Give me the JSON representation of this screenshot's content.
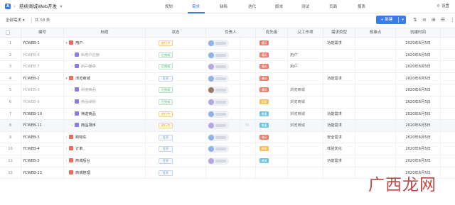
{
  "app": {
    "logo_letter": "A",
    "breadcrumb_sep": "›",
    "project_name": "慈续商城Web开发",
    "project_caret": "▾"
  },
  "nav": {
    "tabs": [
      {
        "label": "规划",
        "active": false
      },
      {
        "label": "需求",
        "active": true
      },
      {
        "label": "缺陷",
        "active": false
      },
      {
        "label": "迭代",
        "active": false
      },
      {
        "label": "版本",
        "active": false
      },
      {
        "label": "测试",
        "active": false
      },
      {
        "label": "页面",
        "active": false
      },
      {
        "label": "报表",
        "active": false
      }
    ],
    "settings_label": "设置",
    "accent": "#3b7be8"
  },
  "toolbar": {
    "view_label": "全部需求 ▾",
    "count_label": "共 58 条",
    "new_button_label": "+ 新建",
    "new_button_caret": "▾",
    "icons": [
      "sort-icon",
      "filter-icon",
      "group-icon",
      "display-icon",
      "more-icon"
    ]
  },
  "table": {
    "headers": [
      "编号",
      "标题",
      "状态",
      "负责人",
      "优先级",
      "父工作项",
      "需求类型",
      "故事点",
      "创建时间"
    ],
    "rows": [
      {
        "num": "1",
        "id": "YCWEB-1",
        "title": "用户",
        "level": 0,
        "kind": "feature",
        "expand": "down",
        "status": "进行中",
        "status_kind": "done",
        "owner": "blue",
        "priority": "最高",
        "priority_kind": "high",
        "parent": "",
        "type": "功能需求",
        "story": "",
        "date": "2020年6月5日",
        "muted": false
      },
      {
        "num": "2",
        "id": "YCWEB-6",
        "title": "新用户注册",
        "level": 1,
        "kind": "story",
        "expand": "right",
        "status": "已完成",
        "status_kind": "closed",
        "owner": "blue",
        "priority": "最高",
        "priority_kind": "high",
        "parent": "用户",
        "type": "",
        "story": "",
        "date": "2020年6月5日",
        "muted": true
      },
      {
        "num": "3",
        "id": "YCWEB-7",
        "title": "用户登录",
        "level": 1,
        "kind": "story",
        "expand": "right",
        "status": "已完成",
        "status_kind": "closed",
        "owner": "purple",
        "priority": "最高",
        "priority_kind": "high",
        "parent": "用户",
        "type": "",
        "story": "",
        "date": "2020年6月5日",
        "muted": true
      },
      {
        "num": "4",
        "id": "YCWEB-2",
        "title": "浏览商城",
        "level": 0,
        "kind": "feature",
        "expand": "down",
        "status": "打开",
        "status_kind": "open",
        "owner": "blue",
        "priority": "最高",
        "priority_kind": "high",
        "parent": "",
        "type": "功能需求",
        "story": "",
        "date": "2020年6月5日",
        "muted": false
      },
      {
        "num": "5",
        "id": "YCWEB-8",
        "title": "浏览商品",
        "level": 1,
        "kind": "story",
        "expand": "right",
        "status": "已完成",
        "status_kind": "closed",
        "owner": "brown",
        "priority": "最高",
        "priority_kind": "high",
        "parent": "浏览商城",
        "type": "",
        "story": "",
        "date": "2020年6月5日",
        "muted": true
      },
      {
        "num": "6",
        "id": "YCWEB-9",
        "title": "商品详情",
        "level": 1,
        "kind": "story",
        "expand": "right",
        "status": "已完成",
        "status_kind": "closed",
        "owner": "purple",
        "priority": "较高",
        "priority_kind": "mid",
        "parent": "浏览商城",
        "type": "",
        "story": "",
        "date": "2020年6月5日",
        "muted": true
      },
      {
        "num": "7",
        "id": "YCWEB-10",
        "title": "筛选商品",
        "level": 1,
        "kind": "story",
        "expand": "right",
        "status": "进行中",
        "status_kind": "done",
        "owner": "blue",
        "priority": "普通",
        "priority_kind": "low",
        "parent": "浏览商城",
        "type": "功能需求",
        "story": "",
        "date": "2020年6月5日",
        "muted": false
      },
      {
        "num": "8",
        "id": "YCWEB-11",
        "title": "商品排序",
        "level": 1,
        "kind": "story",
        "expand": "right",
        "status": "进行中",
        "status_kind": "done",
        "owner": "purple",
        "priority": "普通",
        "priority_kind": "low",
        "parent": "浏览商城",
        "type": "功能需求",
        "story": "",
        "date": "2020年6月5日",
        "muted": false,
        "selected": true
      },
      {
        "num": "9",
        "id": "YCWEB-3",
        "title": "购物车",
        "level": 0,
        "kind": "feature",
        "expand": "right",
        "status": "打开",
        "status_kind": "open",
        "owner": "blue",
        "priority": "最高",
        "priority_kind": "high",
        "parent": "",
        "type": "安全需求",
        "story": "",
        "date": "2020年6月5日",
        "muted": false
      },
      {
        "num": "10",
        "id": "YCWEB-4",
        "title": "订单",
        "level": 0,
        "kind": "feature",
        "expand": "right",
        "status": "打开",
        "status_kind": "open",
        "owner": "blue",
        "priority": "较高",
        "priority_kind": "mid",
        "parent": "",
        "type": "体验优化",
        "story": "",
        "date": "2020年6月5日",
        "muted": false
      },
      {
        "num": "11",
        "id": "YCWEB-5",
        "title": "商城后台",
        "level": 0,
        "kind": "feature",
        "expand": "right",
        "status": "打开",
        "status_kind": "open",
        "owner": "purple",
        "priority": "普通",
        "priority_kind": "low",
        "parent": "",
        "type": "功能需求",
        "story": "",
        "date": "2020年6月5日",
        "muted": false
      },
      {
        "num": "12",
        "id": "YCWEB-23",
        "title": "商城管理",
        "level": 0,
        "kind": "feature",
        "expand": "none",
        "status": "打开",
        "status_kind": "open",
        "owner": "none",
        "priority": "",
        "priority_kind": "",
        "parent": "",
        "type": "",
        "story": "",
        "date": "2020年6月5日",
        "muted": false
      }
    ]
  },
  "watermark": {
    "text": "广西龙网"
  }
}
